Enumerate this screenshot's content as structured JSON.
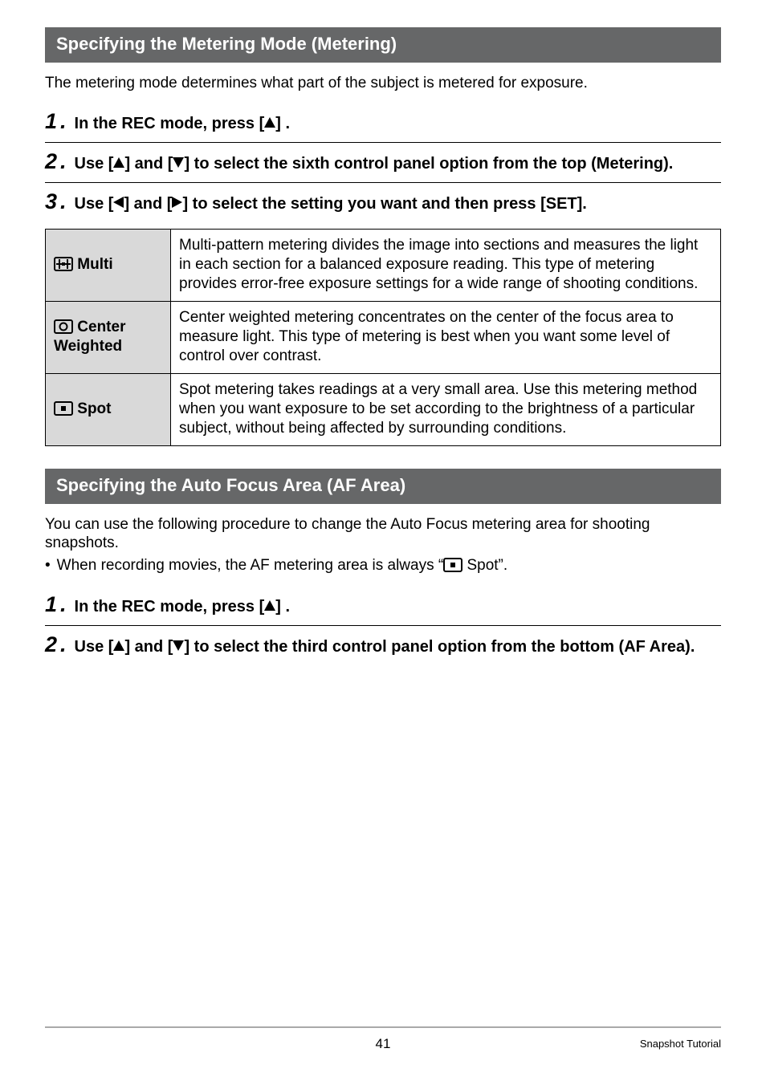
{
  "section1": {
    "title": "Specifying the Metering Mode (Metering)",
    "intro": "The metering mode determines what part of the subject is metered for exposure.",
    "step1": "In the REC mode, press [",
    "step1_suffix": "] .",
    "step2_prefix": "Use [",
    "step2_mid": "] and [",
    "step2_suffix": "] to select the sixth control panel option from the top (Metering).",
    "step3_prefix": "Use [",
    "step3_mid": "] and [",
    "step3_suffix": "] to select the setting you want and then press [SET]."
  },
  "table": {
    "rows": [
      {
        "label": "Multi",
        "desc": "Multi-pattern metering divides the image into sections and measures the light in each section for a balanced exposure reading. This type of metering provides error-free exposure settings for a wide range of shooting conditions."
      },
      {
        "label": "Center Weighted",
        "desc": "Center weighted metering concentrates on the center of the focus area to measure light. This type of metering is best when you want some level of control over contrast."
      },
      {
        "label": "Spot",
        "desc": "Spot metering takes readings at a very small area. Use this metering method when you want exposure to be set according to the brightness of a particular subject, without being affected by surrounding conditions."
      }
    ]
  },
  "section2": {
    "title": "Specifying the Auto Focus Area (AF Area)",
    "intro": "You can use the following procedure to change the Auto Focus metering area for shooting snapshots.",
    "bullet_prefix": "When recording movies, the AF metering area is always “",
    "bullet_suffix": " Spot”.",
    "step1": "In the REC mode, press [",
    "step1_suffix": "] .",
    "step2_prefix": "Use [",
    "step2_mid": "] and [",
    "step2_suffix": "] to select the third control panel option from the bottom (AF Area)."
  },
  "footer": {
    "page": "41",
    "right": "Snapshot Tutorial"
  }
}
